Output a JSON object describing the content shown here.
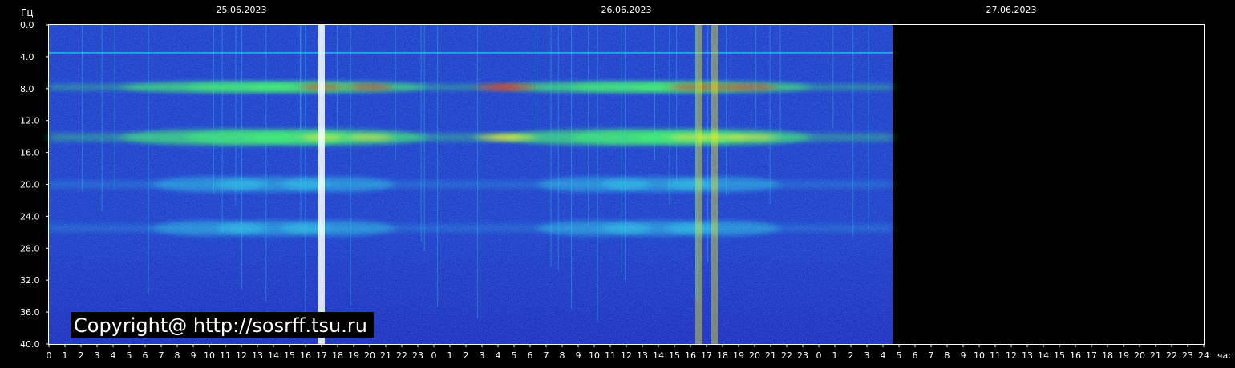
{
  "chart_data": {
    "type": "heatmap",
    "title": "",
    "ylabel": "Гц",
    "xlabel": "час",
    "ylim": [
      0,
      40
    ],
    "yticks": [
      "0.0",
      "4.0",
      "8.0",
      "12.0",
      "16.0",
      "20.0",
      "24.0",
      "28.0",
      "32.0",
      "36.0",
      "40.0"
    ],
    "dates": [
      "25.06.2023",
      "26.06.2023",
      "27.06.2023"
    ],
    "hour_ticks": [
      "0",
      "1",
      "2",
      "3",
      "4",
      "5",
      "6",
      "7",
      "8",
      "9",
      "10",
      "11",
      "12",
      "13",
      "14",
      "15",
      "16",
      "17",
      "18",
      "19",
      "20",
      "21",
      "22",
      "23",
      "0",
      "1",
      "2",
      "3",
      "4",
      "5",
      "6",
      "7",
      "8",
      "9",
      "10",
      "11",
      "12",
      "13",
      "14",
      "15",
      "16",
      "17",
      "18",
      "19",
      "20",
      "21",
      "22",
      "23",
      "0",
      "1",
      "2",
      "3",
      "4",
      "5",
      "6",
      "7",
      "8",
      "9",
      "10",
      "11",
      "12",
      "13",
      "14",
      "15",
      "16",
      "17",
      "18",
      "19",
      "20",
      "21",
      "22",
      "23",
      "24"
    ],
    "data_end_hours": 52.6,
    "resonance_bands_hz": [
      7.8,
      14.1,
      20.0,
      25.5
    ],
    "strong_events_hours": [
      17,
      40.5,
      41.5
    ],
    "grid": false,
    "legend": "none",
    "colors": {
      "background": "#000000",
      "low": "#0a0a9a",
      "mid": "#1560ff",
      "cyan": "#20e0e8",
      "green": "#30f060",
      "yellow": "#e8e820",
      "red": "#e02010",
      "white": "#ffffff"
    }
  },
  "watermark": "Copyright@ http://sosrff.tsu.ru"
}
